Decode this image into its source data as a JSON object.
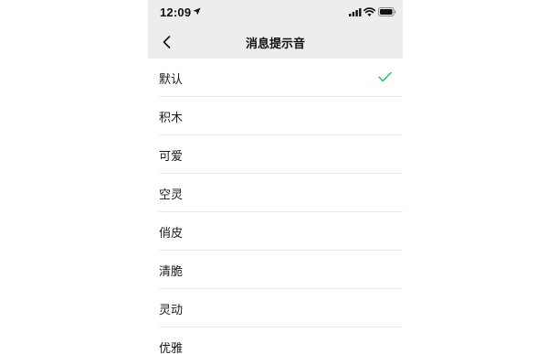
{
  "status_bar": {
    "time": "12:09",
    "icons": [
      "location-arrow-icon",
      "cellular-signal-icon",
      "wifi-icon",
      "battery-icon"
    ]
  },
  "nav": {
    "title": "消息提示音",
    "back_icon": "chevron-left-icon"
  },
  "sounds": {
    "items": [
      {
        "label": "默认",
        "selected": true
      },
      {
        "label": "积木",
        "selected": false
      },
      {
        "label": "可爱",
        "selected": false
      },
      {
        "label": "空灵",
        "selected": false
      },
      {
        "label": "俏皮",
        "selected": false
      },
      {
        "label": "清脆",
        "selected": false
      },
      {
        "label": "灵动",
        "selected": false
      },
      {
        "label": "优雅",
        "selected": false
      }
    ]
  },
  "colors": {
    "bar_background": "#ededed",
    "check_accent": "#07c160",
    "divider": "#ececec"
  }
}
